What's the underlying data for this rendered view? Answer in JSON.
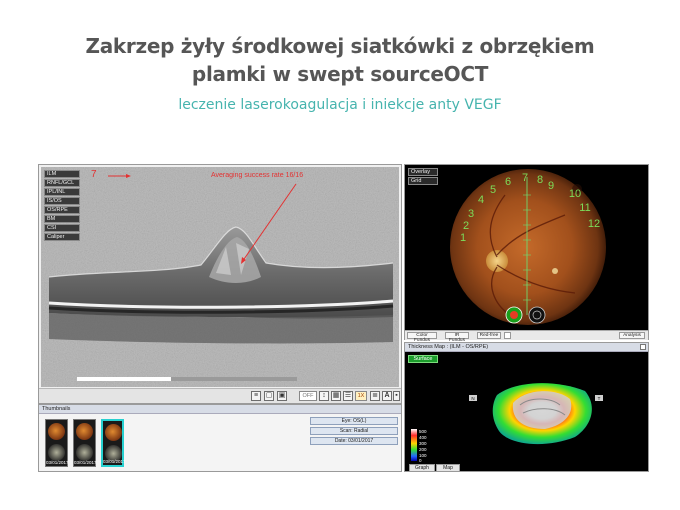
{
  "slide": {
    "title_line1": "Zakrzep żyły środkowej siatkówki z obrzękiem",
    "title_line2": "plamki w swept sourceOCT",
    "subtitle": "leczenie laserokoagulacja i iniekcje anty VEGF"
  },
  "oct": {
    "scan_number": "7",
    "averaging_text": "Averaging success rate 16/16",
    "layers": [
      "ILM",
      "RNFL/GCL",
      "IPL/INL",
      "IS/OS",
      "OS/RPE",
      "BM",
      "CSI",
      "Caliper"
    ],
    "toolbar": {
      "zoom_value": "OFF",
      "scale_value": "1X",
      "text_tool": "A"
    }
  },
  "thumbnails": {
    "header": "Thumbnails",
    "dates": [
      "03/01/2017",
      "03/01/2017",
      "03/01/2017"
    ],
    "info": {
      "eye": "Eye: OS(L)",
      "scan": "Scan: Radial",
      "date": "Date: 03/01/2017"
    }
  },
  "fundus": {
    "menu": [
      "Overlay",
      "Grid"
    ],
    "clock_numbers": [
      "1",
      "2",
      "3",
      "4",
      "5",
      "6",
      "7",
      "8",
      "9",
      "10",
      "11",
      "12"
    ],
    "buttons": {
      "color": "Color Fundus",
      "ir": "IR Fundus",
      "redfree": "Red-free",
      "analysis": "Analysis"
    }
  },
  "thickness": {
    "header": "Thickness Map : (ILM - OS/RPE)",
    "surface_button": "Surface",
    "scale_values": [
      "500",
      "400",
      "300",
      "200",
      "100",
      "0"
    ],
    "tabs": [
      "Graph",
      "Map"
    ],
    "orientation": [
      "N",
      "T"
    ]
  },
  "colors": {
    "title": "#565656",
    "subtitle": "#46b4ae",
    "annotation": "#e33232",
    "selected_thumb": "#27d0d0",
    "surface_green": "#1c9c2c"
  }
}
